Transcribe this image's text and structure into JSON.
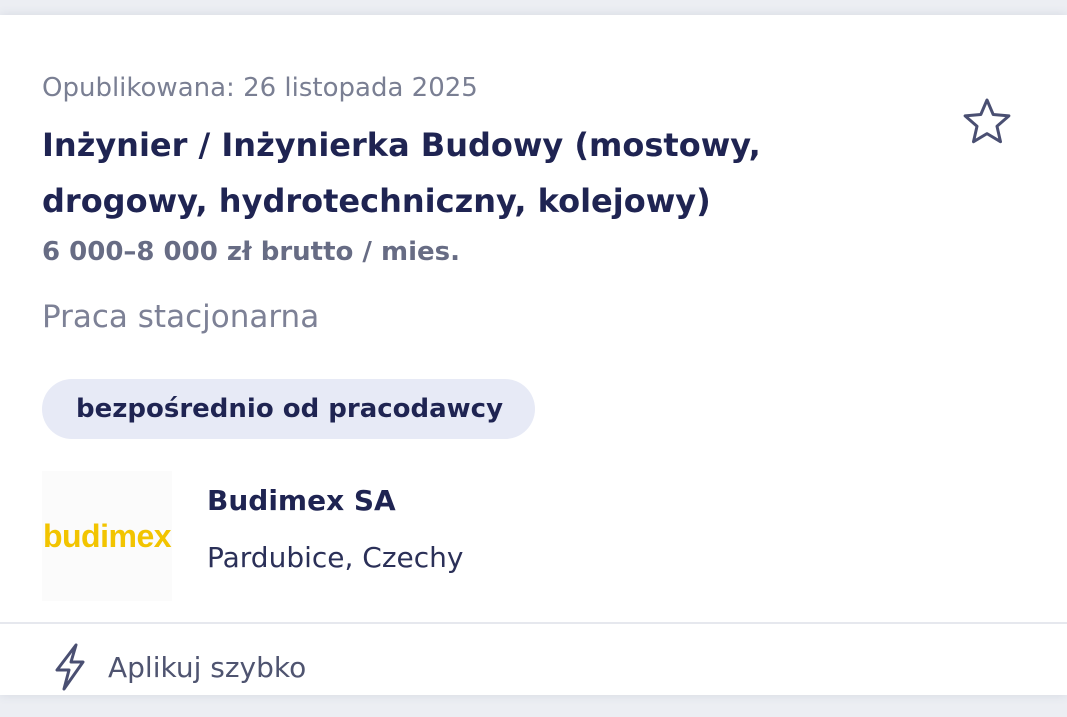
{
  "job": {
    "published": "Opublikowana: 26 listopada 2025",
    "title": "Inżynier / Inżynierka Budowy (mostowy, drogowy, hydrotechniczny, kolejowy)",
    "salary": "6 000–8 000 zł brutto / mies.",
    "work_type": "Praca stacjonarna",
    "badge": "bezpośrednio od pracodawcy"
  },
  "employer": {
    "logo_text": "budimex",
    "name": "Budimex SA",
    "location": "Pardubice, Czechy"
  },
  "actions": {
    "favorite_icon": "star-outline-icon",
    "quick_apply_icon": "lightning-bolt-icon",
    "quick_apply_label": "Aplikuj szybko"
  },
  "colors": {
    "title": "#1f2452",
    "badge_bg": "#e7eaf6",
    "logo": "#f2c400",
    "muted_text": "#7a7f93"
  }
}
